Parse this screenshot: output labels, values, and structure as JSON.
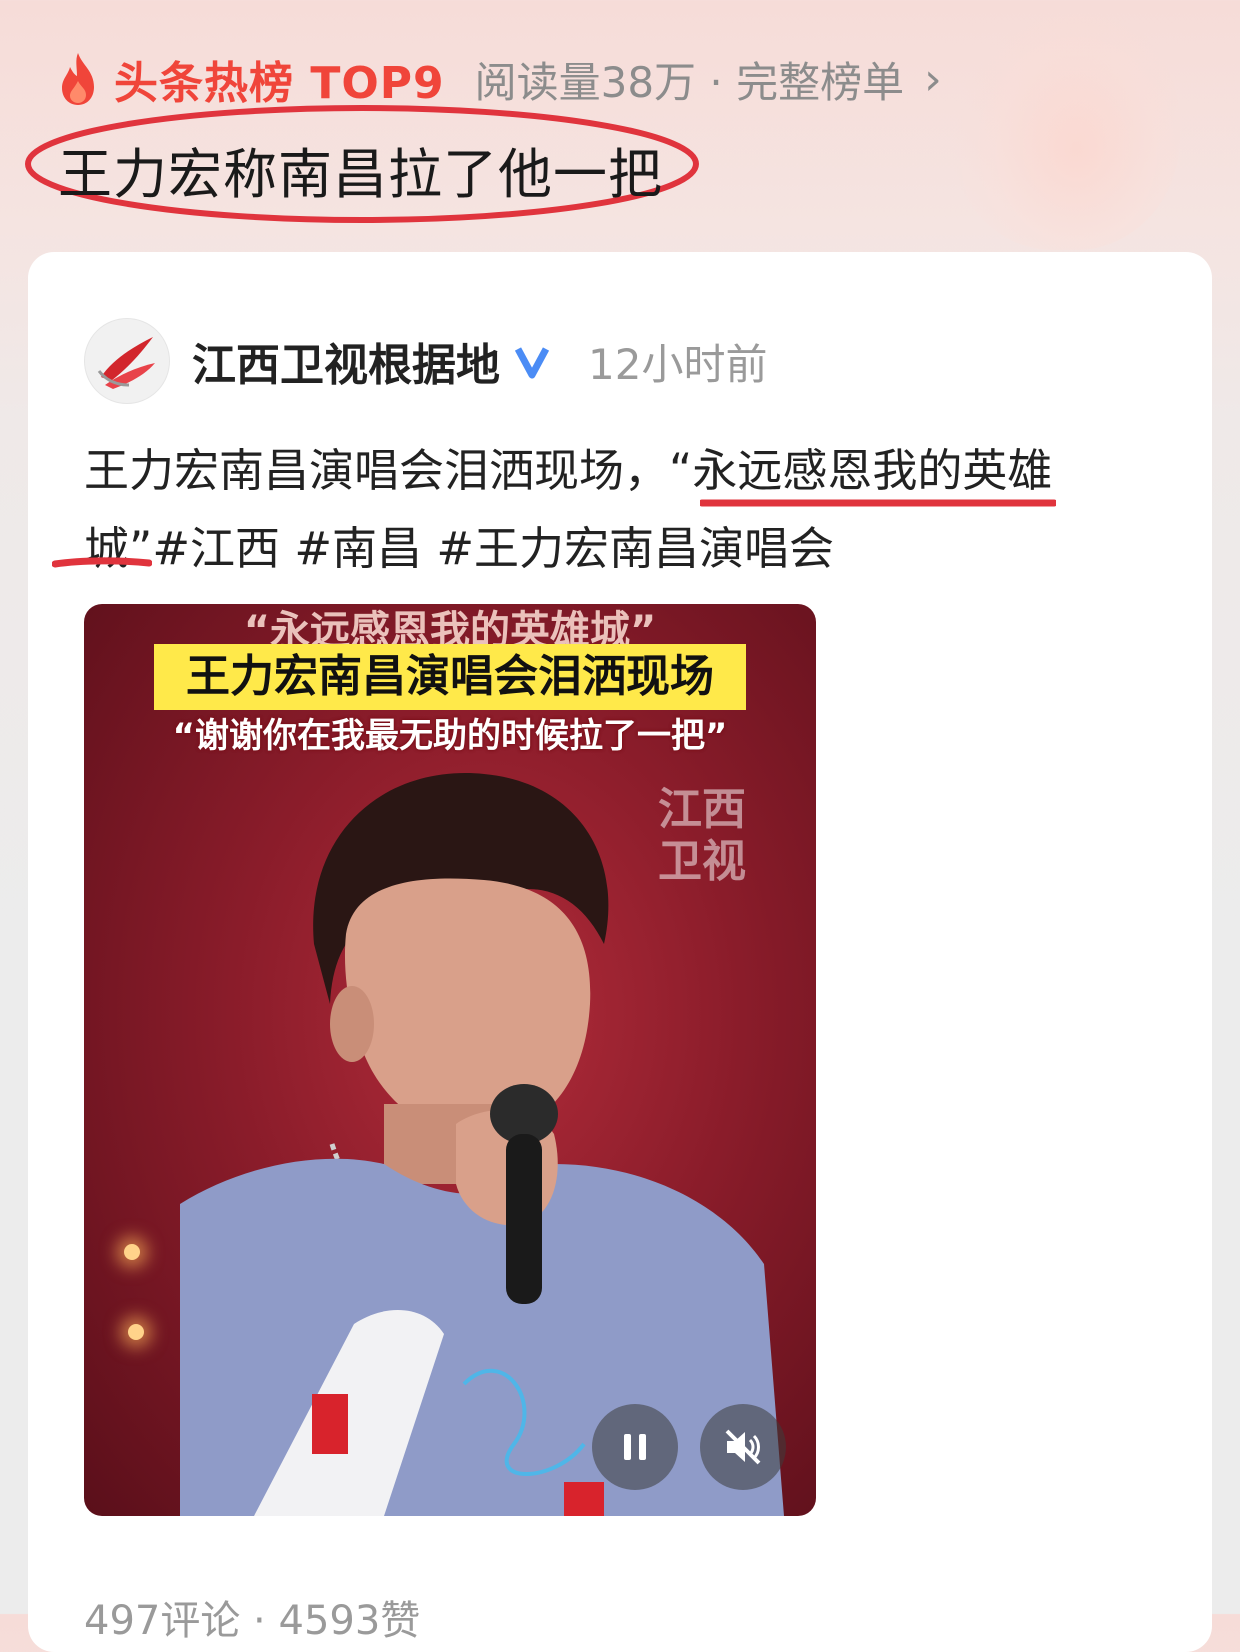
{
  "hot_header": {
    "title": "头条热榜 TOP9",
    "meta": "阅读量38万 · 完整榜单",
    "chevron": "›"
  },
  "headline": "王力宏称南昌拉了他一把",
  "post": {
    "author": "江西卫视根据地",
    "time": "12小时前",
    "text_line1": "王力宏南昌演唱会泪洒现场，“永远感恩我的英雄",
    "text_line2": "城”#江西 #南昌 #王力宏南昌演唱会"
  },
  "video": {
    "caption_top": "“永远感恩我的英雄城”",
    "caption_main": "王力宏南昌演唱会泪洒现场",
    "caption_quote": "“谢谢你在我最无助的时候拉了一把”",
    "watermark": "江西卫视"
  },
  "stats": "497评论 · 4593赞",
  "colors": {
    "accent": "#f0453a",
    "annotation": "#e0343d",
    "verified": "#4b8cf5",
    "caption_bg": "#ffe94a"
  }
}
